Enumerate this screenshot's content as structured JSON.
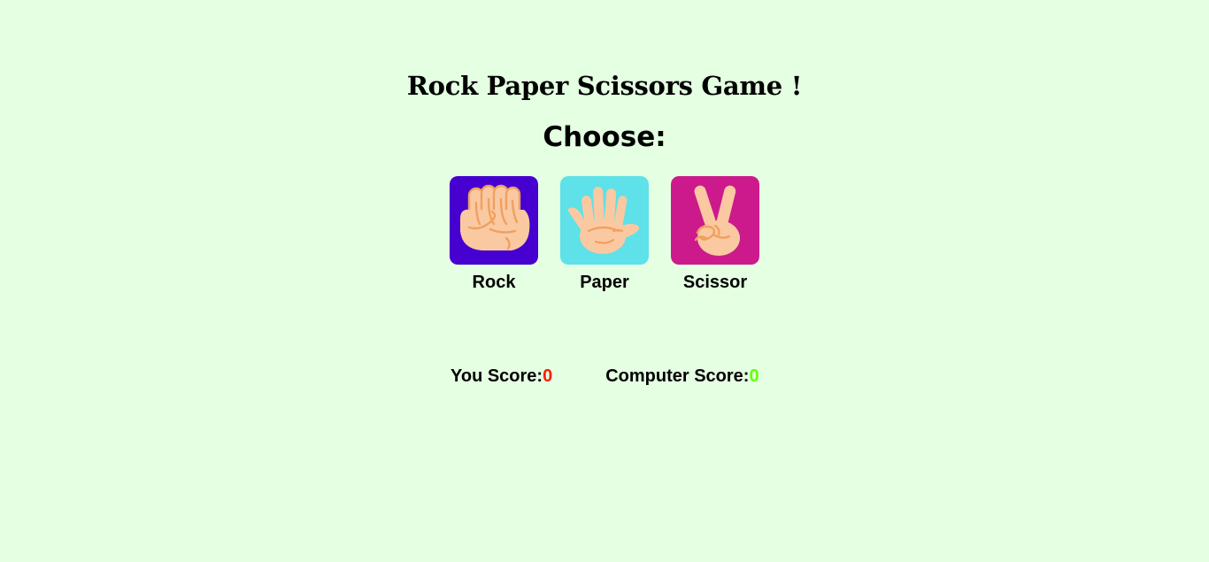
{
  "title": "Rock Paper Scissors Game !",
  "prompt": "Choose:",
  "choices": [
    {
      "id": "rock",
      "label": "Rock",
      "bg_color": "#4600d0",
      "icon": "fist-icon"
    },
    {
      "id": "paper",
      "label": "Paper",
      "bg_color": "#5ee1e8",
      "icon": "open-hand-icon"
    },
    {
      "id": "scissor",
      "label": "Scissor",
      "bg_color": "#cc1a8c",
      "icon": "peace-hand-icon"
    }
  ],
  "scores": {
    "user_label": "You Score:",
    "user_value": "0",
    "user_color": "#ff1a00",
    "computer_label": "Computer Score:",
    "computer_value": "0",
    "computer_color": "#66ff00"
  },
  "colors": {
    "background": "#e4ffe2",
    "skin": "#fac9a1",
    "skin_line": "#f0a060"
  }
}
